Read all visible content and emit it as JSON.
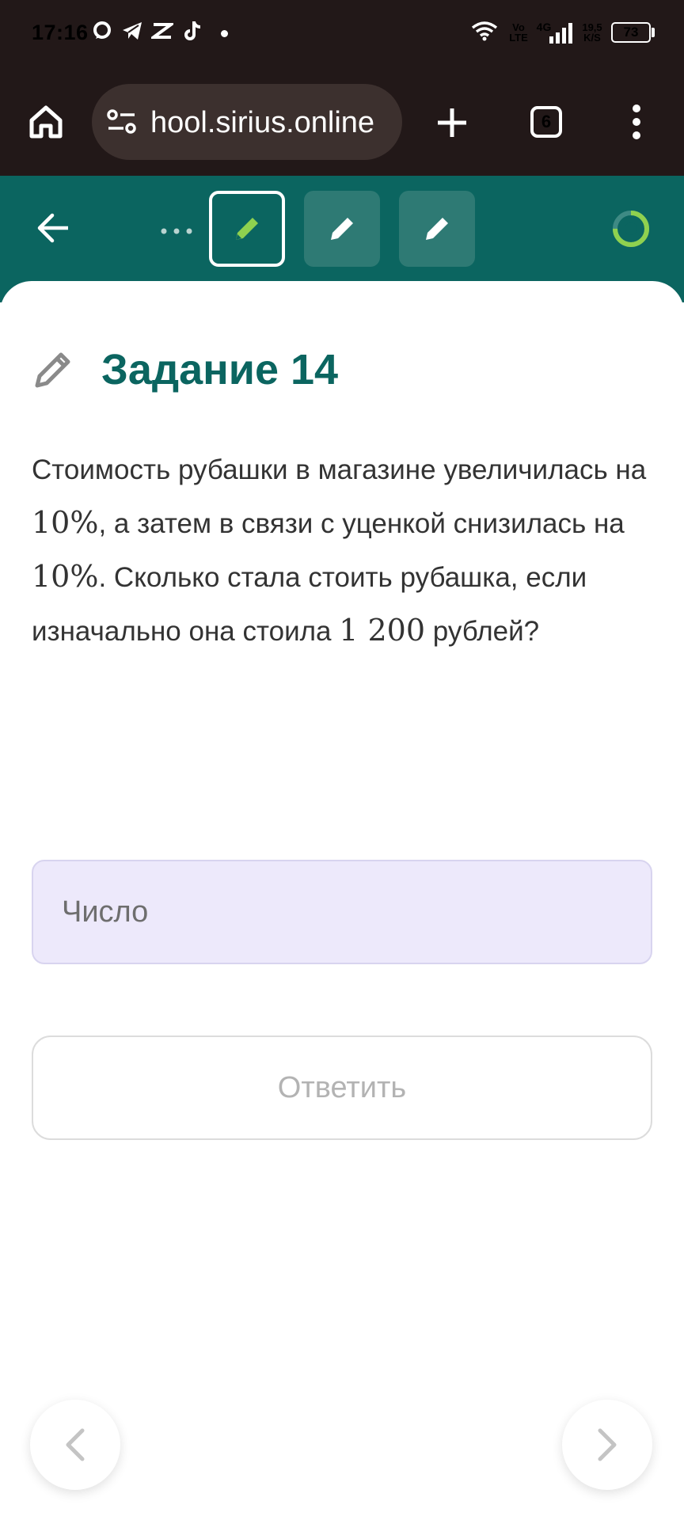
{
  "status_bar": {
    "time": "17:16",
    "volte_top": "Vo",
    "volte_bottom": "LTE",
    "network": "4G",
    "speed_top": "19,5",
    "speed_bottom": "K/S",
    "battery": "73"
  },
  "browser": {
    "url": "hool.sirius.online",
    "tab_count": "6"
  },
  "header": {
    "progress_fraction": 0.75,
    "accent_color": "#0b6560",
    "active_pencil_color": "#8fd14f"
  },
  "task": {
    "title": "Задание 14",
    "problem": {
      "p1": "Стоимость рубашки в магазине увеличилась на ",
      "m1": "10%",
      "p2": ", а затем в связи с уценкой снизилась на ",
      "m2": "10%",
      "p3": ". Сколько стала стоить рубашка, если изначально она стоила ",
      "m3": "1 200",
      "p4": " рублей?"
    },
    "input_placeholder": "Число",
    "answer_button": "Ответить"
  }
}
